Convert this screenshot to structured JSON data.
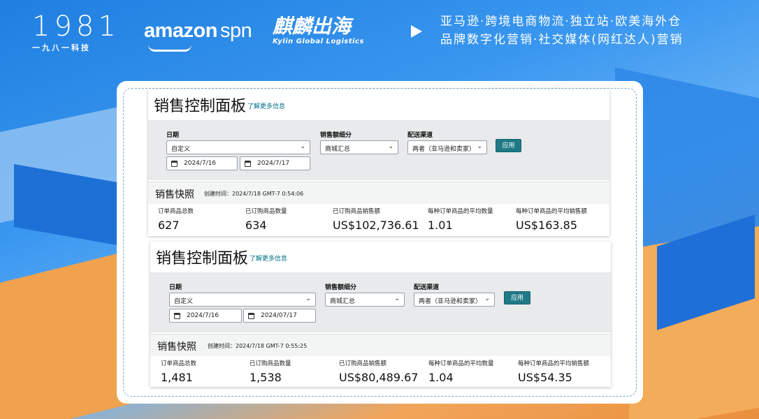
{
  "header": {
    "logo_1981_number": "1981",
    "logo_1981_sub": "一九八一科技",
    "logo_amazon": "amazon",
    "logo_spn": "spn",
    "logo_kylin_cn": "麒麟出海",
    "logo_kylin_en": "Kylin Global Logistics",
    "tagline_line1": "亚马逊·跨境电商物流·独立站·欧美海外仓",
    "tagline_line2": "品牌数字化营销·社交媒体(网红达人)营销"
  },
  "dashboards": [
    {
      "title": "销售控制面板",
      "learn_more": "了解更多信息",
      "date_label": "日期",
      "date_range": "自定义",
      "start_date": "2024/7/16",
      "end_date": "2024/7/17",
      "breakdown_label": "销售额细分",
      "breakdown_value": "商城汇总",
      "channel_label": "配送渠道",
      "channel_value": "两者（亚马逊和卖家）",
      "apply_label": "应用",
      "snapshot_title": "销售快照",
      "snapshot_time": "创建时间：2024/7/18 GMT-7 0:54:06",
      "metrics": [
        {
          "label": "订单商品总数",
          "value": "627"
        },
        {
          "label": "已订购商品数量",
          "value": "634"
        },
        {
          "label": "已订购商品销售额",
          "value": "US$102,736.61"
        },
        {
          "label": "每种订单商品的平均数量",
          "value": "1.01"
        },
        {
          "label": "每种订单商品的平均销售额",
          "value": "US$163.85"
        }
      ]
    },
    {
      "title": "销售控制面板",
      "learn_more": "了解更多信息",
      "date_label": "日期",
      "date_range": "自定义",
      "start_date": "2024/7/16",
      "end_date": "2024/07/17",
      "breakdown_label": "销售额细分",
      "breakdown_value": "商城汇总",
      "channel_label": "配送渠道",
      "channel_value": "两者（亚马逊和卖家）",
      "apply_label": "应用",
      "snapshot_title": "销售快照",
      "snapshot_time": "创建时间：2024/7/18 GMT-7 0:55:25",
      "metrics": [
        {
          "label": "订单商品总数",
          "value": "1,481"
        },
        {
          "label": "已订购商品数量",
          "value": "1,538"
        },
        {
          "label": "已订购商品销售额",
          "value": "US$80,489.67"
        },
        {
          "label": "每种订单商品的平均数量",
          "value": "1.04"
        },
        {
          "label": "每种订单商品的平均销售额",
          "value": "US$54.35"
        }
      ]
    }
  ],
  "icons": {
    "play": "play-icon",
    "calendar": "calendar-icon",
    "chevron": "chevron-down-icon"
  }
}
